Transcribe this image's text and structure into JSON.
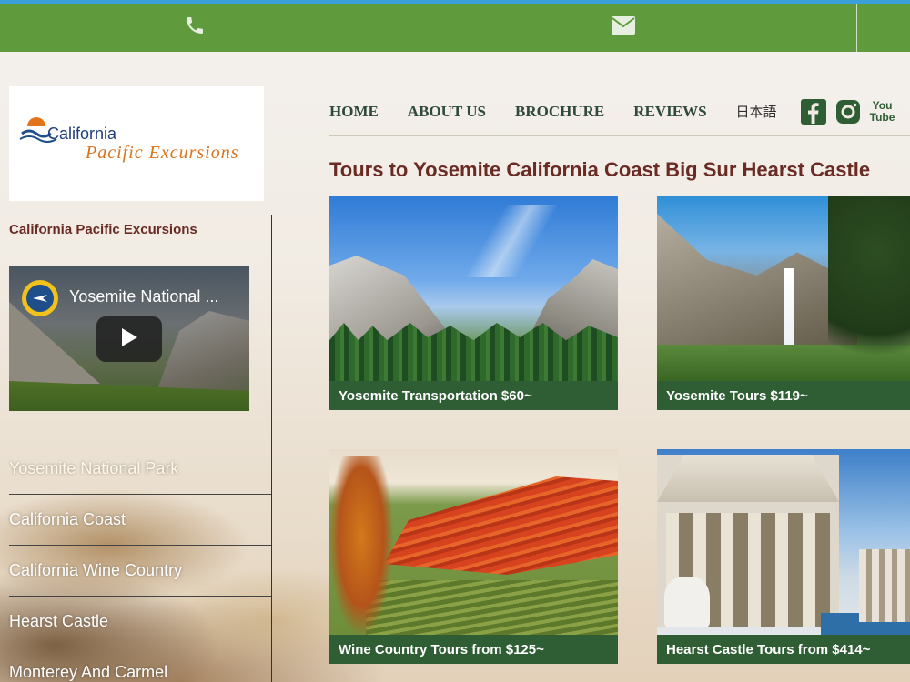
{
  "topbar": {
    "phone_icon": "phone-icon",
    "mail_icon": "envelope-icon",
    "color": "#5f9b3c"
  },
  "logo": {
    "line1": "California",
    "line2": "Pacific Excursions"
  },
  "sidebar": {
    "title": "California Pacific Excursions",
    "video_title": "Yosemite National ...",
    "nav": [
      {
        "label": "Yosemite National Park"
      },
      {
        "label": "California Coast"
      },
      {
        "label": "California Wine Country"
      },
      {
        "label": "Hearst Castle"
      },
      {
        "label": "Monterey And Carmel"
      }
    ]
  },
  "mainnav": {
    "links": [
      {
        "label": "HOME"
      },
      {
        "label": "ABOUT US"
      },
      {
        "label": "BROCHURE"
      },
      {
        "label": "REVIEWS"
      },
      {
        "label": "日本語"
      }
    ],
    "social": [
      "facebook-icon",
      "instagram-icon",
      "youtube-icon"
    ],
    "youtube_text": "You Tube"
  },
  "heading": "Tours to Yosemite California Coast Big Sur Hearst Castle",
  "cards": [
    {
      "caption": "Yosemite Transportation $60~"
    },
    {
      "caption": "Yosemite Tours $119~"
    },
    {
      "caption": "Wine Country Tours from $125~"
    },
    {
      "caption": "Hearst Castle Tours from $414~"
    }
  ],
  "colors": {
    "accent_green": "#5f9b3c",
    "caption_green": "#2f5e34",
    "heading_maroon": "#6b2b25",
    "nav_dark_green": "#2f4a3a"
  }
}
